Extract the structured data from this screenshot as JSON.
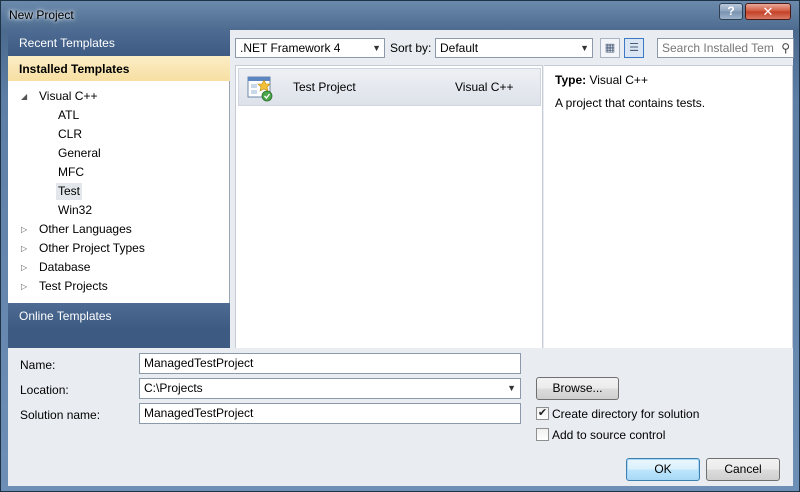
{
  "window": {
    "title": "New Project"
  },
  "titlebar": {
    "help_glyph": "?",
    "close_glyph": "✕"
  },
  "left": {
    "recent_header": "Recent Templates",
    "installed_header": "Installed Templates",
    "tree": [
      {
        "label": "Visual C++",
        "expander": "◢",
        "level": 0
      },
      {
        "label": "ATL",
        "expander": "",
        "level": 1
      },
      {
        "label": "CLR",
        "expander": "",
        "level": 1
      },
      {
        "label": "General",
        "expander": "",
        "level": 1
      },
      {
        "label": "MFC",
        "expander": "",
        "level": 1
      },
      {
        "label": "Test",
        "expander": "",
        "level": 1,
        "selected": true
      },
      {
        "label": "Win32",
        "expander": "",
        "level": 1
      },
      {
        "label": "Other Languages",
        "expander": "▷",
        "level": 0
      },
      {
        "label": "Other Project Types",
        "expander": "▷",
        "level": 0
      },
      {
        "label": "Database",
        "expander": "▷",
        "level": 0
      },
      {
        "label": "Test Projects",
        "expander": "▷",
        "level": 0
      }
    ],
    "online_header": "Online Templates"
  },
  "toolbar": {
    "framework": ".NET Framework 4",
    "sort_label": "Sort by:",
    "sort_value": "Default",
    "search_placeholder": "Search Installed Tem",
    "search_icon": "search-icon"
  },
  "templates": [
    {
      "name": "Test Project",
      "language": "Visual C++",
      "icon": "test-project-icon"
    }
  ],
  "description": {
    "type_label": "Type:",
    "type_value": "Visual C++",
    "text": "A project that contains tests."
  },
  "form": {
    "name_label": "Name:",
    "name_value": "ManagedTestProject",
    "location_label": "Location:",
    "location_value": "C:\\Projects",
    "solution_label": "Solution name:",
    "solution_value": "ManagedTestProject",
    "browse_label": "Browse...",
    "create_dir_label": "Create directory for solution",
    "create_dir_checked": true,
    "source_control_label": "Add to source control",
    "source_control_checked": false,
    "ok_label": "OK",
    "cancel_label": "Cancel"
  },
  "colors": {
    "header_blue": "#3c5a82",
    "installed_highlight": "#f7dfa2",
    "chrome": "#5d7ea5",
    "client_bg": "#e9ecf1"
  }
}
